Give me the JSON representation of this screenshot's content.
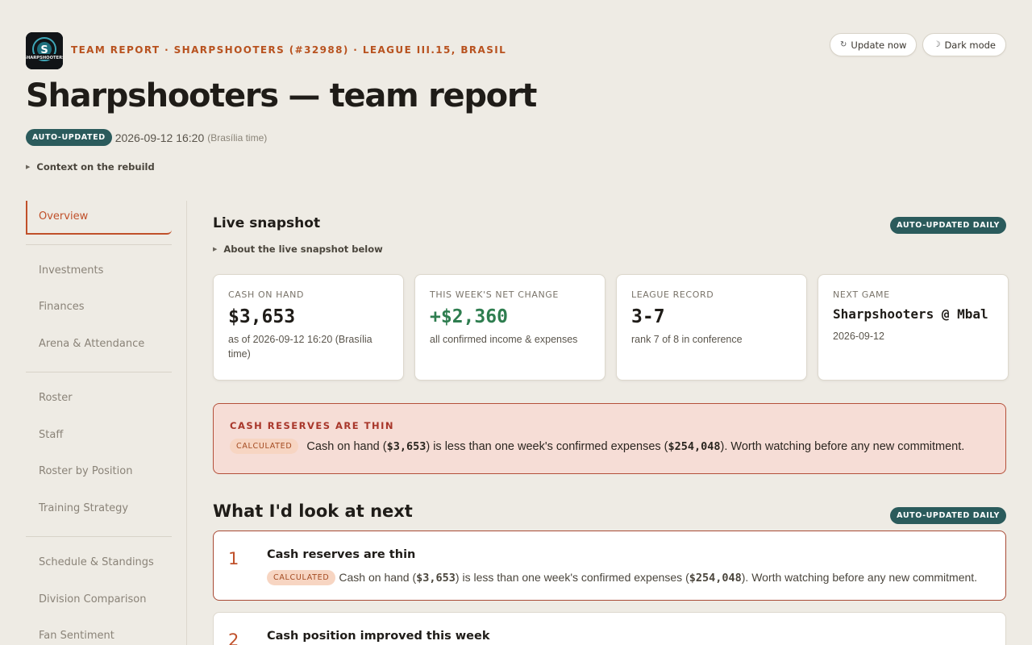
{
  "header": {
    "kicker": "TEAM REPORT · SHARPSHOOTERS (#32988) · LEAGUE III.15, BRASIL",
    "title": "Sharpshooters — team report",
    "logo_text": "SHARPSHOOTERS",
    "update_button": "Update now",
    "dark_mode_button": "Dark mode",
    "badge": "AUTO-UPDATED",
    "timestamp": "2026-09-12 16:20",
    "timezone": "(Brasília time)",
    "context_toggle": "Context on the rebuild"
  },
  "sidebar": {
    "groups": [
      [
        "Overview"
      ],
      [
        "Investments",
        "Finances",
        "Arena & Attendance"
      ],
      [
        "Roster",
        "Staff",
        "Roster by Position",
        "Training Strategy"
      ],
      [
        "Schedule & Standings",
        "Division Comparison",
        "Fan Sentiment"
      ]
    ],
    "active": "Overview"
  },
  "snapshot": {
    "title": "Live snapshot",
    "badge": "AUTO-UPDATED DAILY",
    "about_toggle": "About the live snapshot below",
    "cards": [
      {
        "label": "CASH ON HAND",
        "value": "$3,653",
        "sub": "as of 2026-09-12 16:20 (Brasília time)"
      },
      {
        "label": "THIS WEEK'S NET CHANGE",
        "value": "+$2,360",
        "sub": "all confirmed income & expenses"
      },
      {
        "label": "LEAGUE RECORD",
        "value": "3-7",
        "sub": "rank 7 of 8 in conference"
      },
      {
        "label": "NEXT GAME",
        "value": "Sharpshooters @ Mbal",
        "sub": "2026-09-12"
      }
    ]
  },
  "alert": {
    "title": "CASH RESERVES ARE THIN",
    "badge": "CALCULATED",
    "text_a": "Cash on hand (",
    "cash": "$3,653",
    "text_b": ") is less than one week's confirmed expenses (",
    "expenses": "$254,048",
    "text_c": "). Worth watching before any new commitment."
  },
  "next": {
    "title": "What I'd look at next",
    "badge": "AUTO-UPDATED DAILY",
    "items": [
      {
        "number": "1",
        "title": "Cash reserves are thin",
        "badge": "CALCULATED",
        "text_a": "Cash on hand (",
        "cash": "$3,653",
        "text_b": ") is less than one week's confirmed expenses (",
        "expenses": "$254,048",
        "text_c": "). Worth watching before any new commitment."
      },
      {
        "number": "2",
        "title": "Cash position improved this week"
      }
    ]
  },
  "colors": {
    "accent": "#c0502a",
    "teal_badge": "#2b5b5c",
    "positive": "#2e7d4f",
    "alert_bg": "#f6ddd6"
  }
}
